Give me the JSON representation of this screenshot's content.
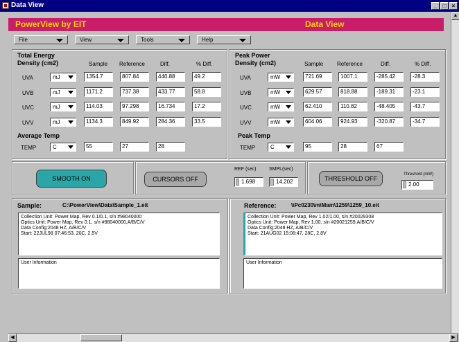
{
  "window": {
    "title": "Data View"
  },
  "header": {
    "app_name": "PowerView by EIT",
    "view_name": "Data View"
  },
  "menu": [
    "File",
    "View",
    "Tools",
    "Help"
  ],
  "energy": {
    "title_line1": "Total Energy",
    "title_line2": "Density (cm2)",
    "columns": [
      "Sample",
      "Reference",
      "Diff.",
      "% Diff."
    ],
    "rows": [
      {
        "label": "UVA",
        "unit": "mJ",
        "sample": "1354.7",
        "reference": "807.84",
        "diff": "446.88",
        "pct": "49.2"
      },
      {
        "label": "UVB",
        "unit": "mJ",
        "sample": "1171.2",
        "reference": "737.38",
        "diff": "433.77",
        "pct": "58.8"
      },
      {
        "label": "UVC",
        "unit": "mJ",
        "sample": "114.03",
        "reference": "97.298",
        "diff": "16.734",
        "pct": "17.2"
      },
      {
        "label": "UVV",
        "unit": "mJ",
        "sample": "1134.3",
        "reference": "849.92",
        "diff": "284.36",
        "pct": "33.5"
      }
    ],
    "temp_title": "Average Temp",
    "temp": {
      "label": "TEMP",
      "unit": "C",
      "sample": "55",
      "reference": "27",
      "diff": "28"
    }
  },
  "power": {
    "title_line1": "Peak Power",
    "title_line2": "Density (cm2)",
    "columns": [
      "Sample",
      "Reference",
      "Diff.",
      "% Diff."
    ],
    "rows": [
      {
        "label": "UVA",
        "unit": "mW",
        "sample": "721.69",
        "reference": "1007.1",
        "diff": "-285.42",
        "pct": "-28.3"
      },
      {
        "label": "UVB",
        "unit": "mW",
        "sample": "629.57",
        "reference": "818.88",
        "diff": "-189.31",
        "pct": "-23.1"
      },
      {
        "label": "UVC",
        "unit": "mW",
        "sample": "62.410",
        "reference": "110.82",
        "diff": "-48.405",
        "pct": "-43.7"
      },
      {
        "label": "UVV",
        "unit": "mW",
        "sample": "604.06",
        "reference": "924.93",
        "diff": "-320.87",
        "pct": "-34.7"
      }
    ],
    "temp_title": "Peak Temp",
    "temp": {
      "label": "TEMP",
      "unit": "C",
      "sample": "95",
      "reference": "28",
      "diff": "67"
    }
  },
  "controls": {
    "smooth": "SMOOTH ON",
    "cursors": "CURSORS OFF",
    "ref_label": "REF (sec)",
    "ref_value": "1.698",
    "smpl_label": "SMPL(sec)",
    "smpl_value": "14.202",
    "threshold_btn": "THRESHOLD OFF",
    "threshold_label": "Threshold (mW)",
    "threshold_value": "2.00"
  },
  "sample": {
    "title": "Sample:",
    "path": "C:\\PowerView\\Data\\Sample_1.eit",
    "info": [
      "Collection Unit: Power Map, Rev 0.1/0.1, s/n #98040000",
      "Optics Unit: Power Map, Rev 0.1, s/n #98040000,A/B/C/V",
      "Data Config:2048 HZ, A/B/C/V",
      "Start:  22JUL98 07:46:53, 20C, 2.5V"
    ],
    "user_info": "User Information"
  },
  "reference": {
    "title": "Reference:",
    "path": "\\\\Pc0230\\m\\Mam\\1259\\1259_10.eit",
    "info": [
      "Collection Unit: Power Map, Rev 1.02/1.00, s/n #20029308",
      "Optics Unit: Power Map, Rev 1.00, s/n #20021259,A/B/C/V",
      "Data Config:2048 HZ, A/B/C/V",
      "Start:  21AUG02 15:08:47, 28C, 2.8V"
    ],
    "user_info": "User Information"
  },
  "colors": {
    "header_bg": "#c81e6a",
    "header_text": "#ffd000",
    "smooth_on": "#2aa6a6",
    "off_button": "#a8a8a8",
    "titlebar": "#000080"
  }
}
